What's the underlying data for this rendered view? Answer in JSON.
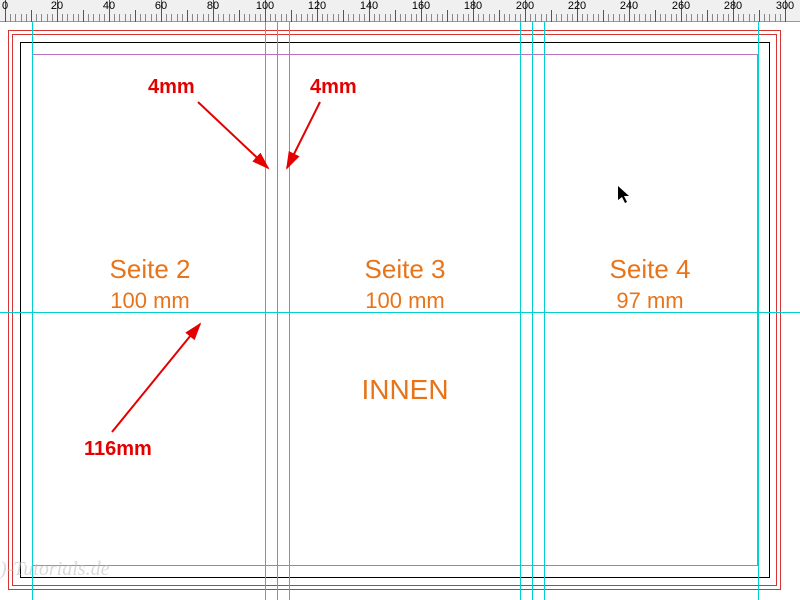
{
  "ruler": {
    "major": [
      0,
      20,
      40,
      60,
      80,
      100,
      120,
      140,
      160,
      180,
      200,
      220,
      240,
      260,
      280
    ]
  },
  "annot": {
    "gap_left": "4mm",
    "gap_right": "4mm",
    "mid_label": "116mm"
  },
  "pages": [
    {
      "label": "Seite 2",
      "width": "100 mm"
    },
    {
      "label": "Seite 3",
      "width": "100 mm"
    },
    {
      "label": "Seite 4",
      "width": "97 mm"
    }
  ],
  "inner": "INNEN",
  "watermark": ")-Tutorials.de"
}
